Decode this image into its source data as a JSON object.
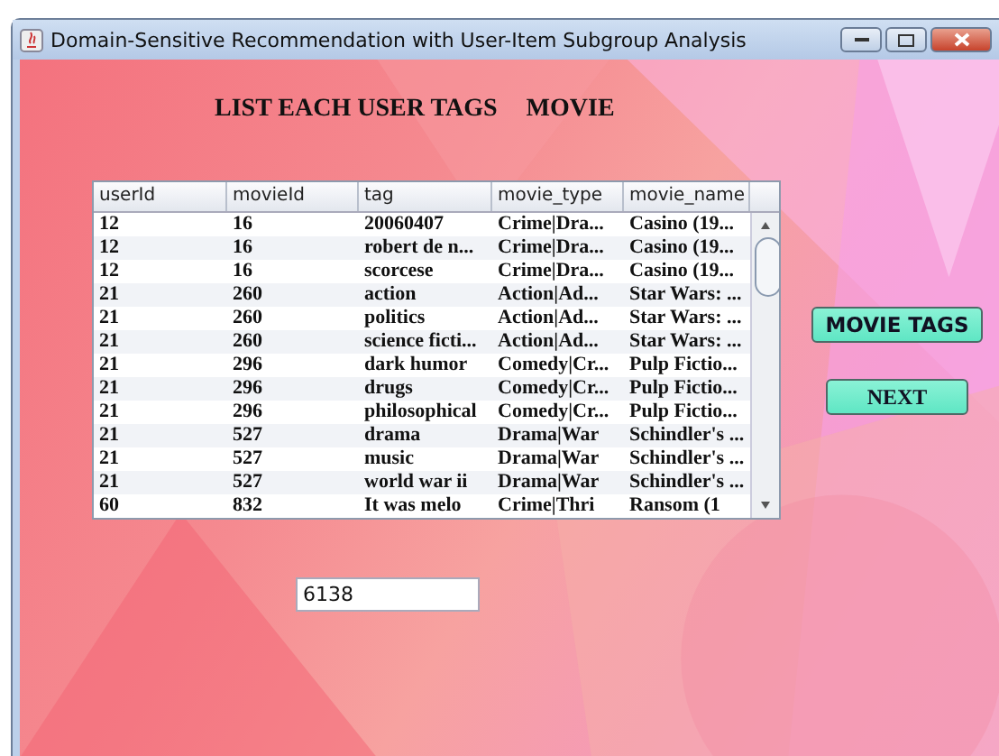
{
  "window": {
    "title": "Domain-Sensitive Recommendation with User-Item Subgroup Analysis"
  },
  "heading": {
    "title": "LIST EACH USER TAGS",
    "subtitle": "MOVIE"
  },
  "table": {
    "columns": [
      "userId",
      "movieId",
      "tag",
      "movie_type",
      "movie_name"
    ],
    "rows": [
      [
        "12",
        "16",
        "20060407",
        "Crime|Dra...",
        "Casino (19..."
      ],
      [
        "12",
        "16",
        "robert de n...",
        "Crime|Dra...",
        "Casino (19..."
      ],
      [
        "12",
        "16",
        "scorcese",
        "Crime|Dra...",
        "Casino (19..."
      ],
      [
        "21",
        "260",
        "action",
        "Action|Ad...",
        "Star Wars: ..."
      ],
      [
        "21",
        "260",
        "politics",
        "Action|Ad...",
        "Star Wars: ..."
      ],
      [
        "21",
        "260",
        "science ficti...",
        "Action|Ad...",
        "Star Wars: ..."
      ],
      [
        "21",
        "296",
        "dark humor",
        "Comedy|Cr...",
        "Pulp Fictio..."
      ],
      [
        "21",
        "296",
        "drugs",
        "Comedy|Cr...",
        "Pulp Fictio..."
      ],
      [
        "21",
        "296",
        "philosophical",
        "Comedy|Cr...",
        "Pulp Fictio..."
      ],
      [
        "21",
        "527",
        "drama",
        "Drama|War",
        "Schindler's ..."
      ],
      [
        "21",
        "527",
        "music",
        "Drama|War",
        "Schindler's ..."
      ],
      [
        "21",
        "527",
        "world war ii",
        "Drama|War",
        "Schindler's ..."
      ],
      [
        "60",
        "832",
        "It was melo",
        "Crime|Thri",
        "Ransom (1"
      ]
    ]
  },
  "buttons": [
    {
      "label": "MOVIE TAGS"
    },
    {
      "label": "NEXT"
    }
  ],
  "field": {
    "value": "6138"
  }
}
